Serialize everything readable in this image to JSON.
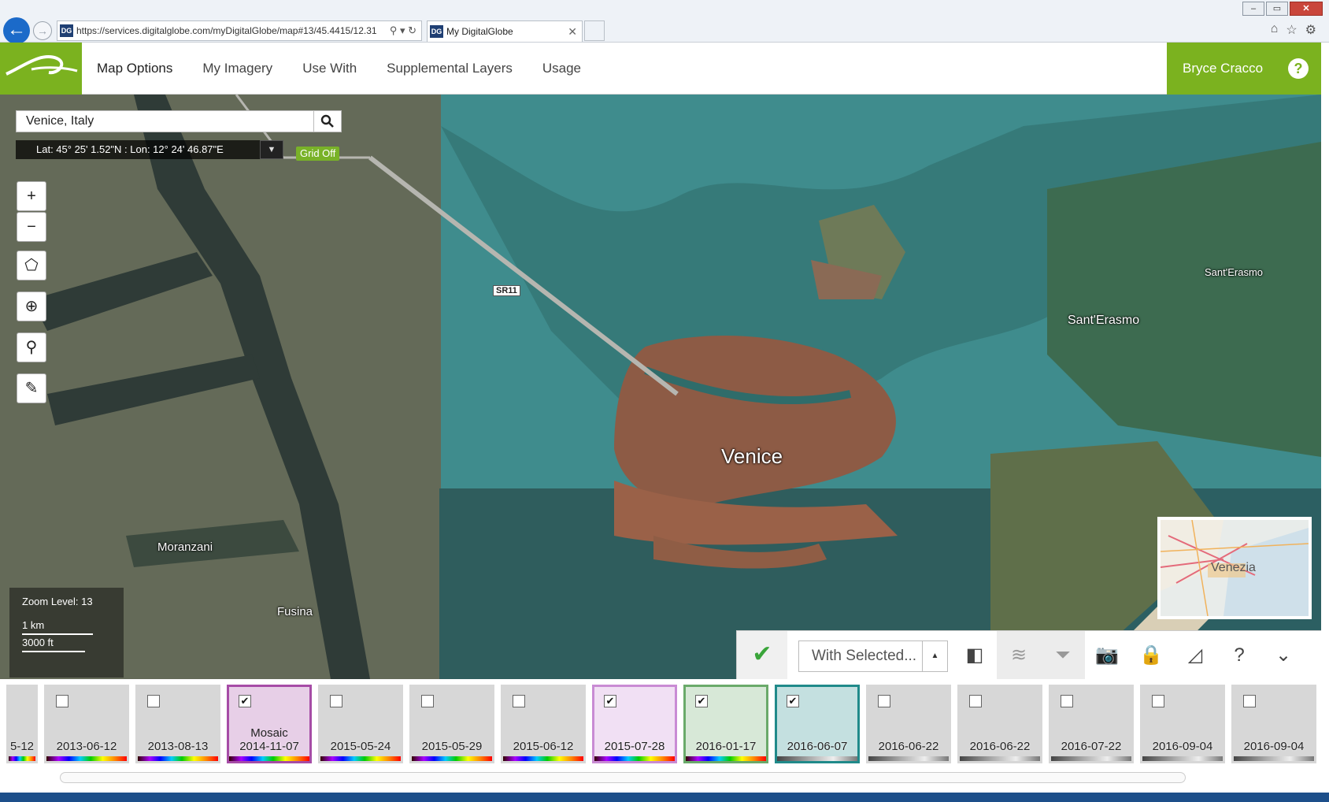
{
  "browser": {
    "url": "https://services.digitalglobe.com/myDigitalGlobe/map#13/45.4415/12.31",
    "tab_title": "My DigitalGlobe",
    "tab_favicon": "DG",
    "window_buttons": [
      "–",
      "▭",
      "✕"
    ]
  },
  "nav": {
    "items": [
      "Map Options",
      "My Imagery",
      "Use With",
      "Supplemental Layers",
      "Usage"
    ],
    "user": "Bryce Cracco",
    "help": "?"
  },
  "map": {
    "search_value": "Venice, Italy",
    "coordinates": "Lat: 45° 25' 1.52\"N : Lon: 12° 24' 46.87\"E",
    "grid_toggle": "Grid Off",
    "labels": {
      "venice": "Venice",
      "sant_erasmo_1": "Sant'Erasmo",
      "sant_erasmo_2": "Sant'Erasmo",
      "moranzani": "Moranzani",
      "fusina": "Fusina",
      "road": "SR11",
      "overview": "Venezia"
    },
    "zoom_level": "Zoom Level: 13",
    "scale_metric": "1 km",
    "scale_imperial": "3000 ft"
  },
  "toolbar": {
    "with_selected": "With Selected...",
    "icons": [
      "check-icon",
      "compare-icon",
      "layers-icon",
      "filter-icon",
      "camera-icon",
      "lock-icon",
      "slider-icon",
      "help-icon",
      "collapse-icon"
    ]
  },
  "timeline": {
    "first_partial": "5-12",
    "cards": [
      {
        "date": "2013-06-12",
        "checked": false,
        "sub": "",
        "color": ""
      },
      {
        "date": "2013-08-13",
        "checked": false,
        "sub": "",
        "color": ""
      },
      {
        "date": "2014-11-07",
        "checked": true,
        "sub": "Mosaic",
        "color": "#a64ca6"
      },
      {
        "date": "2015-05-24",
        "checked": false,
        "sub": "",
        "color": ""
      },
      {
        "date": "2015-05-29",
        "checked": false,
        "sub": "",
        "color": ""
      },
      {
        "date": "2015-06-12",
        "checked": false,
        "sub": "",
        "color": ""
      },
      {
        "date": "2015-07-28",
        "checked": true,
        "sub": "",
        "color": "#c98bd4"
      },
      {
        "date": "2016-01-17",
        "checked": true,
        "sub": "",
        "color": "#6aaa6a"
      },
      {
        "date": "2016-06-07",
        "checked": true,
        "sub": "",
        "color": "#208a8a"
      },
      {
        "date": "2016-06-22",
        "checked": false,
        "sub": "",
        "color": ""
      },
      {
        "date": "2016-06-22",
        "checked": false,
        "sub": "",
        "color": ""
      },
      {
        "date": "2016-07-22",
        "checked": false,
        "sub": "",
        "color": ""
      },
      {
        "date": "2016-09-04",
        "checked": false,
        "sub": "",
        "color": ""
      },
      {
        "date": "2016-09-04",
        "checked": false,
        "sub": "",
        "color": ""
      }
    ]
  },
  "colors": {
    "brand_green": "#7bb21f",
    "lagoon": "#3a8b8c"
  }
}
